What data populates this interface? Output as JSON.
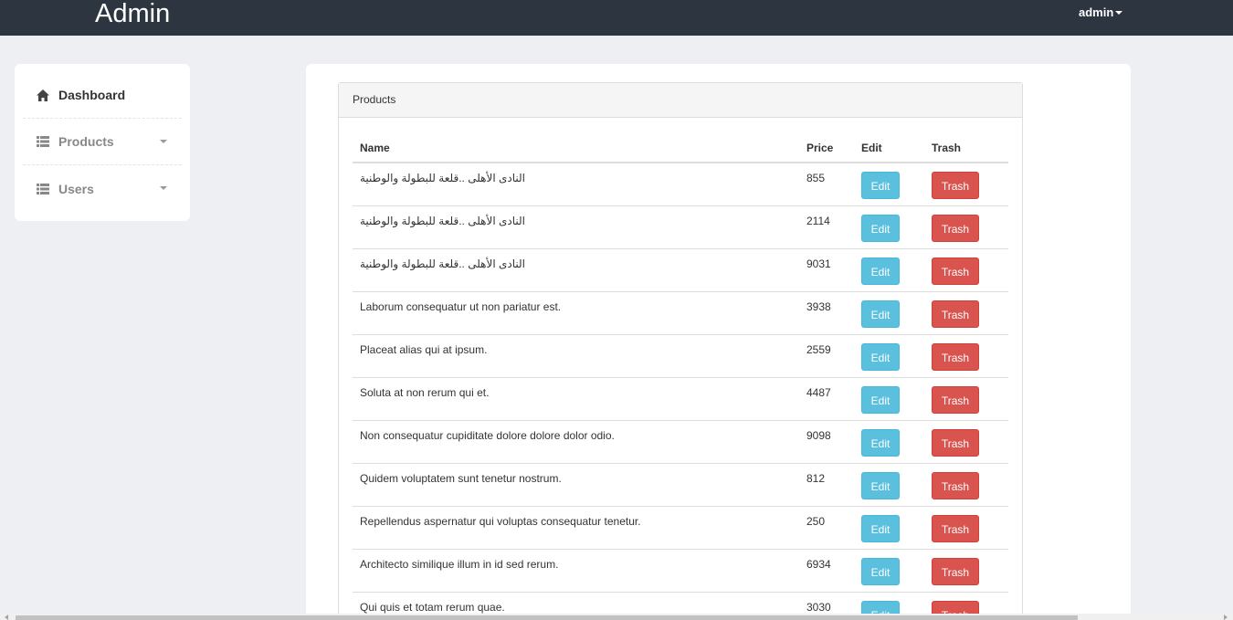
{
  "navbar": {
    "brand": "Admin",
    "user": "admin"
  },
  "sidebar": {
    "items": [
      {
        "label": "Dashboard",
        "icon": "home-icon"
      },
      {
        "label": "Products",
        "icon": "list-icon"
      },
      {
        "label": "Users",
        "icon": "list-icon"
      }
    ]
  },
  "panel": {
    "title": "Products"
  },
  "table": {
    "headers": [
      "Name",
      "Price",
      "Edit",
      "Trash"
    ],
    "edit_label": "Edit",
    "trash_label": "Trash",
    "rows": [
      {
        "name": "النادى الأهلى ..قلعة للبطولة والوطنية",
        "price": "855"
      },
      {
        "name": "النادى الأهلى ..قلعة للبطولة والوطنية",
        "price": "2114"
      },
      {
        "name": "النادى الأهلى ..قلعة للبطولة والوطنية",
        "price": "9031"
      },
      {
        "name": "Laborum consequatur ut non pariatur est.",
        "price": "3938"
      },
      {
        "name": "Placeat alias qui at ipsum.",
        "price": "2559"
      },
      {
        "name": "Soluta at non rerum qui et.",
        "price": "4487"
      },
      {
        "name": "Non consequatur cupiditate dolore dolore dolor odio.",
        "price": "9098"
      },
      {
        "name": "Quidem voluptatem sunt tenetur nostrum.",
        "price": "812"
      },
      {
        "name": "Repellendus aspernatur qui voluptas consequatur tenetur.",
        "price": "250"
      },
      {
        "name": "Architecto similique illum in id sed rerum.",
        "price": "6934"
      },
      {
        "name": "Qui quis et totam rerum quae.",
        "price": "3030"
      }
    ]
  },
  "colors": {
    "navbar": "#2c3540",
    "edit_button": "#5bc0de",
    "trash_button": "#d9534f",
    "background": "#eeeff2"
  }
}
